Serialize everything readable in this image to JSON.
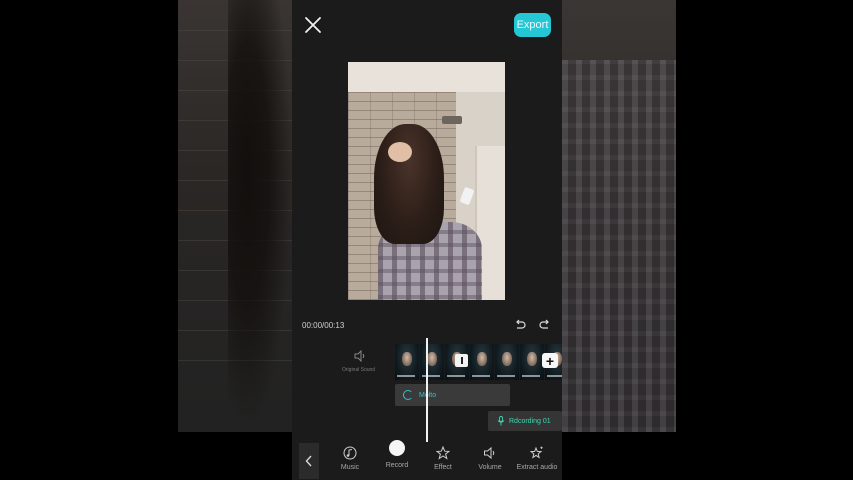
{
  "top": {
    "export_label": "Export"
  },
  "player": {
    "timecode": "00:00/00:13"
  },
  "timeline": {
    "original_sound_label": "Original Sound",
    "music_clip_label": "Molto",
    "recording_clip_label": "Rdcording 01"
  },
  "toolbar": {
    "items": [
      {
        "label": "Music",
        "icon": "music-note-icon"
      },
      {
        "label": "Record",
        "icon": "record-dot-icon"
      },
      {
        "label": "Effect",
        "icon": "star-icon"
      },
      {
        "label": "Volume",
        "icon": "speaker-icon"
      },
      {
        "label": "Extract audio",
        "icon": "sparkle-star-icon"
      }
    ]
  },
  "colors": {
    "accent": "#25c7d4",
    "recording": "#3dd8b0",
    "panel": "#1b1b1b"
  }
}
